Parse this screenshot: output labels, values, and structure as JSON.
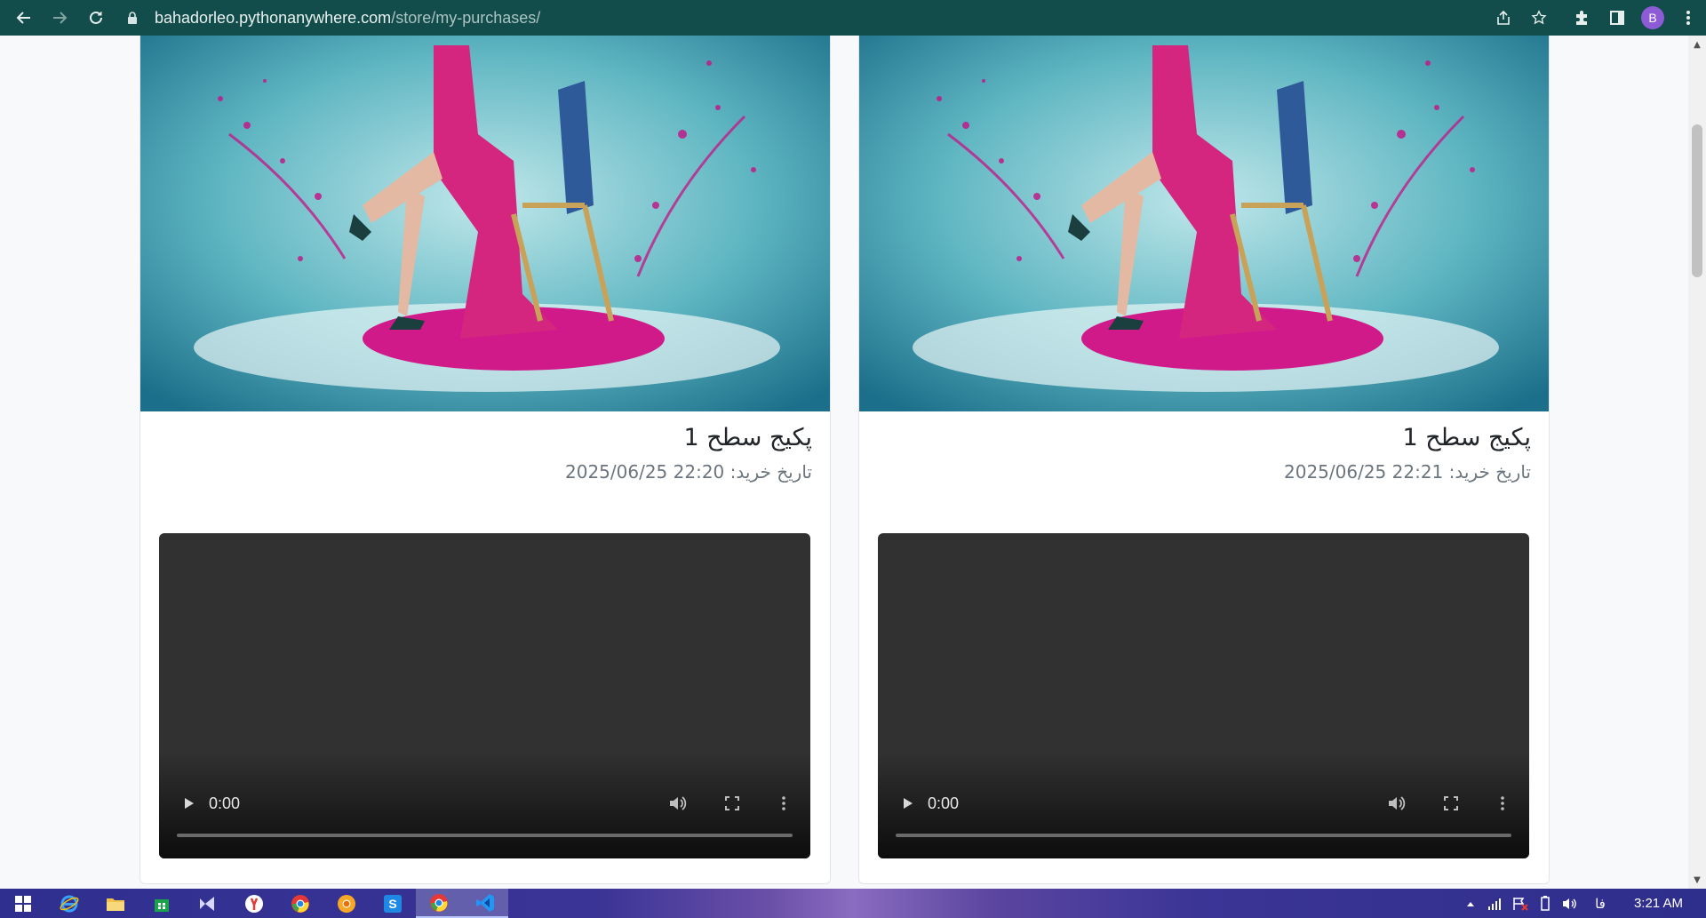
{
  "browser": {
    "url_host": "bahadorleo.pythonanywhere.com",
    "url_path": "/store/my-purchases/",
    "avatar_letter": "B",
    "bar_color": "#124c4b"
  },
  "purchases": [
    {
      "title": "پکیج سطح 1",
      "date_label": "تاریخ خرید:",
      "date_value": "2025/06/25 22:21",
      "video_time": "0:00"
    },
    {
      "title": "پکیج سطح 1",
      "date_label": "تاریخ خرید:",
      "date_value": "2025/06/25 22:20",
      "video_time": "0:00"
    }
  ],
  "taskbar": {
    "language": "فا",
    "clock": "3:21 AM",
    "apps": [
      "windows-start",
      "internet-explorer",
      "file-explorer",
      "store",
      "visual-studio",
      "yandex",
      "chrome",
      "chrome-canary",
      "skype",
      "chrome-active",
      "vscode"
    ]
  }
}
